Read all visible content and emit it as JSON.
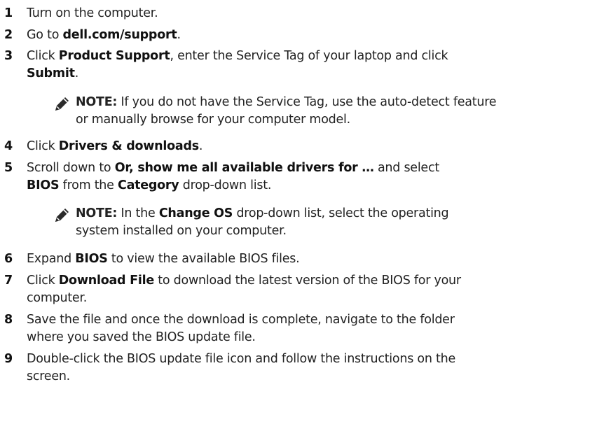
{
  "steps": [
    {
      "num": "1",
      "parts": [
        {
          "t": "Turn on the computer."
        }
      ]
    },
    {
      "num": "2",
      "parts": [
        {
          "t": "Go to "
        },
        {
          "t": "dell.com/support",
          "b": true
        },
        {
          "t": "."
        }
      ]
    },
    {
      "num": "3",
      "line1": [
        {
          "t": "Click "
        },
        {
          "t": "Product Support",
          "b": true
        },
        {
          "t": ", enter the Service Tag of your laptop and click"
        }
      ],
      "line2": [
        {
          "t": "Submit",
          "b": true
        },
        {
          "t": "."
        }
      ]
    },
    {
      "num": "4",
      "parts": [
        {
          "t": "Click "
        },
        {
          "t": "Drivers & downloads",
          "b": true
        },
        {
          "t": "."
        }
      ]
    },
    {
      "num": "5",
      "line1": [
        {
          "t": "Scroll down to "
        },
        {
          "t": "Or, show me all available drivers for …",
          "b": true
        },
        {
          "t": " and select"
        }
      ],
      "line2": [
        {
          "t": "BIOS",
          "b": true
        },
        {
          "t": " from the "
        },
        {
          "t": "Category",
          "b": true
        },
        {
          "t": " drop-down list."
        }
      ]
    },
    {
      "num": "6",
      "parts": [
        {
          "t": "Expand "
        },
        {
          "t": "BIOS",
          "b": true
        },
        {
          "t": " to view the available BIOS files."
        }
      ]
    },
    {
      "num": "7",
      "line1": [
        {
          "t": "Click "
        },
        {
          "t": "Download File",
          "b": true
        },
        {
          "t": " to download the latest version of the BIOS for your"
        }
      ],
      "line2": [
        {
          "t": "computer."
        }
      ]
    },
    {
      "num": "8",
      "line1": [
        {
          "t": "Save the file and once the download is complete, navigate to the folder"
        }
      ],
      "line2": [
        {
          "t": "where you saved the BIOS update file."
        }
      ]
    },
    {
      "num": "9",
      "line1": [
        {
          "t": "Double-click the BIOS update file icon and follow the instructions on the"
        }
      ],
      "line2": [
        {
          "t": "screen."
        }
      ]
    }
  ],
  "notes": [
    {
      "label": "NOTE:",
      "line1": " If you do not have the Service Tag, use the auto-detect feature",
      "line2": "or manually browse for your computer model."
    },
    {
      "label": "NOTE:",
      "line1_parts": [
        {
          "t": " In the "
        },
        {
          "t": "Change OS",
          "b": true
        },
        {
          "t": " drop-down list, select the operating"
        }
      ],
      "line2": "system installed on your computer."
    }
  ],
  "icons": {
    "note": "pencil-note-icon"
  }
}
